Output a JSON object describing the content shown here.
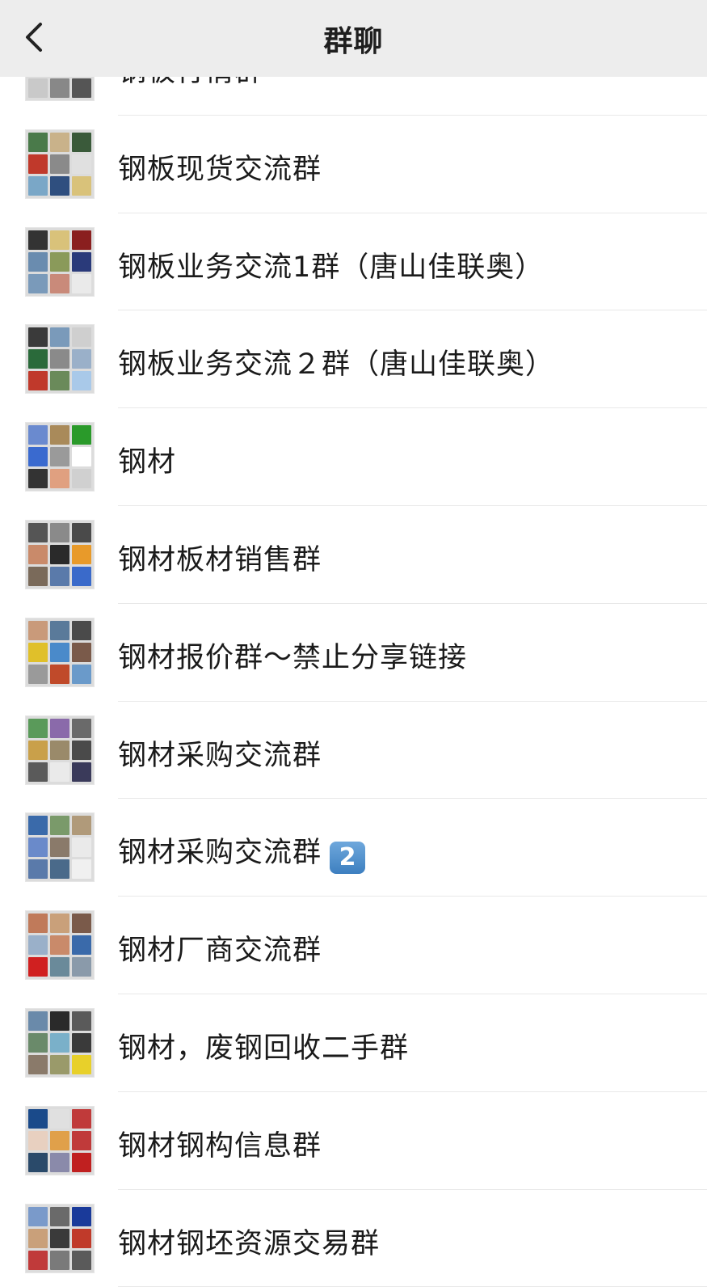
{
  "header": {
    "title": "群聊",
    "back_icon": "chevron-left-icon"
  },
  "colors": {
    "header_bg": "#ededed",
    "badge": "#4a8bc9"
  },
  "groups": [
    {
      "name": "钢板行情群",
      "badge": ""
    },
    {
      "name": "钢板现货交流群",
      "badge": ""
    },
    {
      "name": "钢板业务交流1群（唐山佳联奥）",
      "badge": ""
    },
    {
      "name": "钢板业务交流２群（唐山佳联奥）",
      "badge": ""
    },
    {
      "name": "钢材",
      "badge": ""
    },
    {
      "name": "钢材板材销售群",
      "badge": ""
    },
    {
      "name": "钢材报价群～禁止分享链接",
      "badge": ""
    },
    {
      "name": "钢材采购交流群",
      "badge": ""
    },
    {
      "name": "钢材采购交流群",
      "badge": "2"
    },
    {
      "name": "钢材厂商交流群",
      "badge": ""
    },
    {
      "name": "钢材，废钢回收二手群",
      "badge": ""
    },
    {
      "name": "钢材钢构信息群",
      "badge": ""
    },
    {
      "name": "钢材钢坯资源交易群",
      "badge": ""
    }
  ]
}
